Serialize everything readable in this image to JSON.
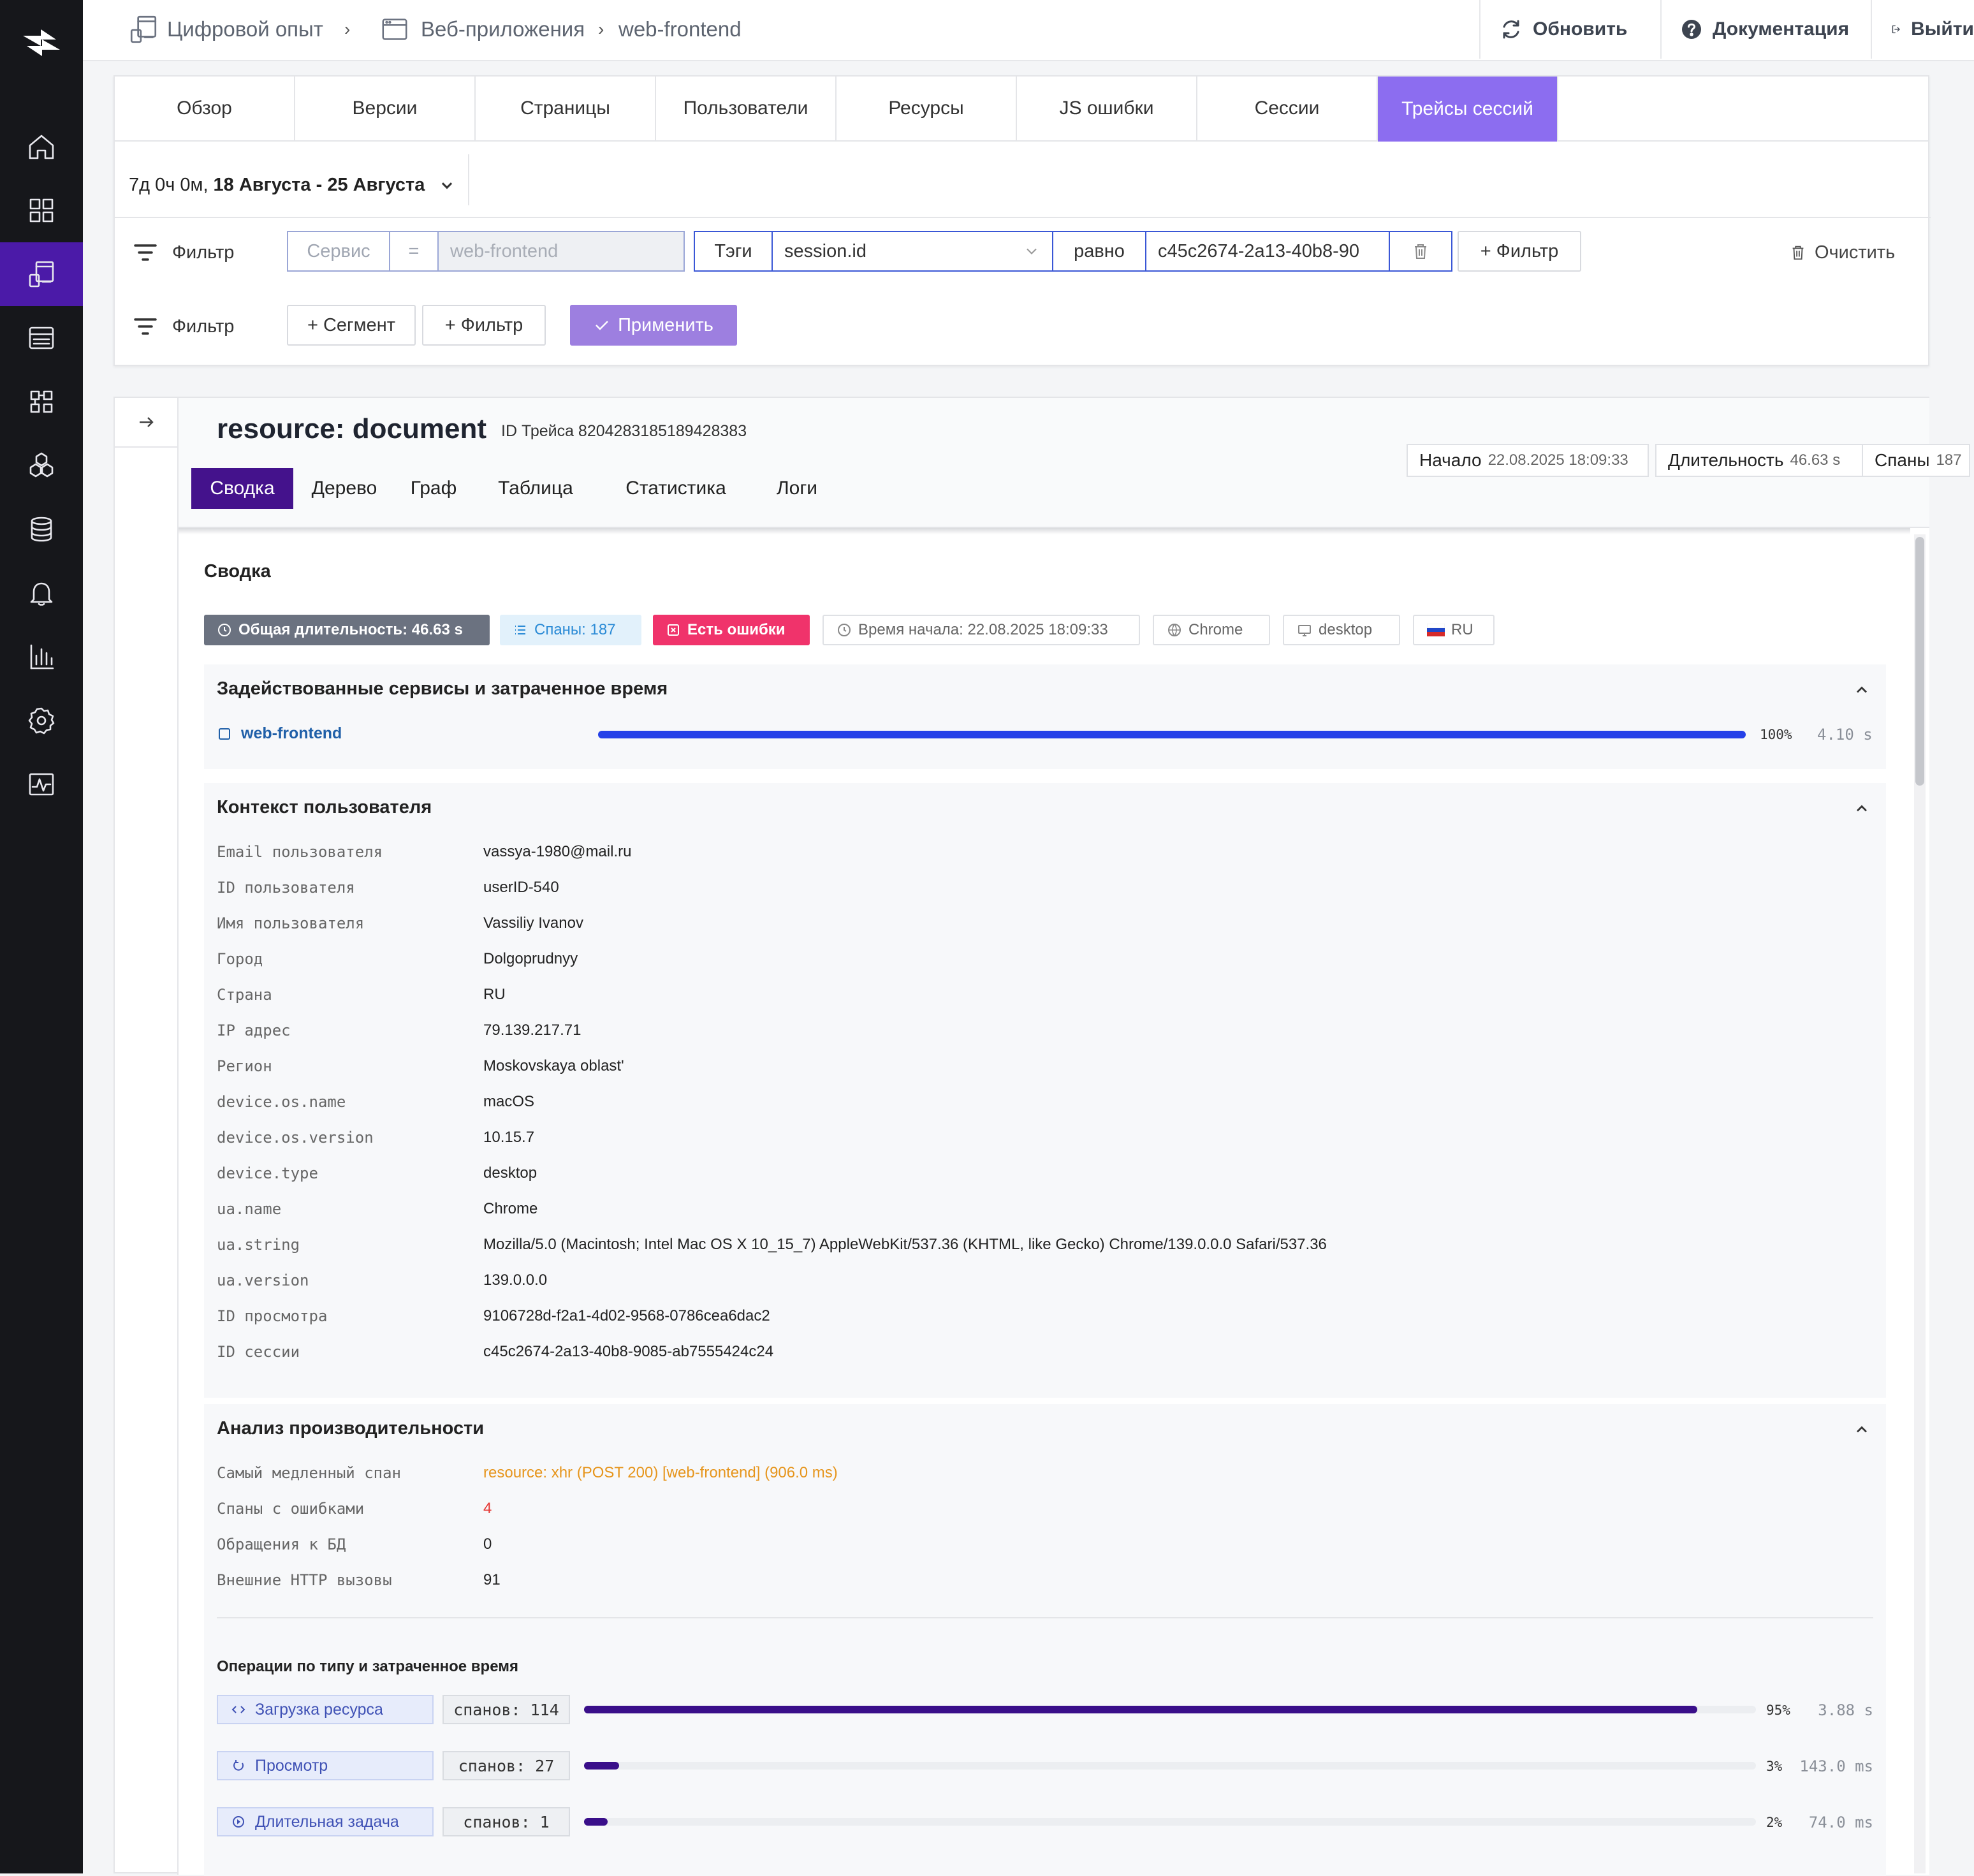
{
  "breadcrumbs": [
    "Цифровой опыт",
    "Веб-приложения",
    "web-frontend"
  ],
  "topbar": {
    "refresh": "Обновить",
    "docs": "Документация",
    "logout": "Выйти"
  },
  "sidebar": {
    "items": [
      {
        "icon": "home-icon"
      },
      {
        "icon": "dashboard-grid-icon"
      },
      {
        "icon": "digital-experience-icon",
        "active": true
      },
      {
        "icon": "logs-list-icon"
      },
      {
        "icon": "modules-icon"
      },
      {
        "icon": "hexagons-icon"
      },
      {
        "icon": "database-icon"
      },
      {
        "icon": "bell-icon"
      },
      {
        "icon": "bar-chart-icon"
      },
      {
        "icon": "settings-gear-icon"
      },
      {
        "icon": "monitoring-pulse-icon"
      }
    ]
  },
  "tabs": [
    "Обзор",
    "Версии",
    "Страницы",
    "Пользователи",
    "Ресурсы",
    "JS ошибки",
    "Сессии",
    "Трейсы сессий"
  ],
  "active_tab": "Трейсы сессий",
  "daterange": {
    "prefix": "7д 0ч 0м,",
    "range": "18 Августа - 25 Августа"
  },
  "filter1": {
    "label": "Фильтр",
    "service_placeholder": "Сервис",
    "op": "=",
    "service_value": "web-frontend",
    "tags_label": "Тэги",
    "tag_key": "session.id",
    "equals_label": "равно",
    "tag_value": "c45c2674-2a13-40b8-90",
    "add_filter": "+ Фильтр",
    "clear": "Очистить"
  },
  "filter2": {
    "label": "Фильтр",
    "add_segment": "+ Сегмент",
    "add_filter": "+ Фильтр",
    "apply": "Применить"
  },
  "trace": {
    "title": "resource: document",
    "id_label": "ID Трейса 8204283185189428383",
    "start_label": "Начало",
    "start_value": "22.08.2025 18:09:33",
    "duration_label": "Длительность",
    "duration_value": "46.63 s",
    "spans_label": "Спаны",
    "spans_value": "187",
    "subtabs": [
      "Сводка",
      "Дерево",
      "Граф",
      "Таблица",
      "Статистика",
      "Логи"
    ],
    "active_subtab": "Сводка"
  },
  "summary": {
    "title": "Сводка",
    "badges": {
      "total_duration": "Общая длительность: 46.63 s",
      "spans": "Спаны: 187",
      "errors": "Есть ошибки",
      "start_time": "Время начала: 22.08.2025 18:09:33",
      "browser": "Chrome",
      "device": "desktop",
      "country": "RU"
    },
    "services": {
      "title": "Задействованные сервисы и затраченное время",
      "rows": [
        {
          "name": "web-frontend",
          "percent": "100%",
          "percent_value": 100,
          "time": "4.10 s"
        }
      ]
    },
    "user_context": {
      "title": "Контекст пользователя",
      "rows": [
        {
          "k": "Email пользователя",
          "v": "vassya-1980@mail.ru"
        },
        {
          "k": "ID пользователя",
          "v": "userID-540"
        },
        {
          "k": "Имя пользователя",
          "v": "Vassiliy Ivanov"
        },
        {
          "k": "Город",
          "v": "Dolgoprudnyy"
        },
        {
          "k": "Страна",
          "v": "RU"
        },
        {
          "k": "IP адрес",
          "v": "79.139.217.71"
        },
        {
          "k": "Регион",
          "v": "Moskovskaya oblast'"
        },
        {
          "k": "device.os.name",
          "v": "macOS"
        },
        {
          "k": "device.os.version",
          "v": "10.15.7"
        },
        {
          "k": "device.type",
          "v": "desktop"
        },
        {
          "k": "ua.name",
          "v": "Chrome"
        },
        {
          "k": "ua.string",
          "v": "Mozilla/5.0 (Macintosh; Intel Mac OS X 10_15_7) AppleWebKit/537.36 (KHTML, like Gecko) Chrome/139.0.0.0 Safari/537.36"
        },
        {
          "k": "ua.version",
          "v": "139.0.0.0"
        },
        {
          "k": "ID просмотра",
          "v": "9106728d-f2a1-4d02-9568-0786cea6dac2"
        },
        {
          "k": "ID сессии",
          "v": "c45c2674-2a13-40b8-9085-ab7555424c24"
        }
      ]
    },
    "performance": {
      "title": "Анализ производительности",
      "rows": [
        {
          "k": "Самый медленный спан",
          "v": "resource: xhr (POST 200) [web-frontend] (906.0 ms)"
        },
        {
          "k": "Спаны с ошибками",
          "v": "4"
        },
        {
          "k": "Обращения к БД",
          "v": "0"
        },
        {
          "k": "Внешние HTTP вызовы",
          "v": "91"
        }
      ],
      "ops_title": "Операции по типу и затраченное время",
      "ops": [
        {
          "name": "Загрузка ресурса",
          "icon": "code-brackets-icon",
          "count": "спанов: 114",
          "percent": "95%",
          "percent_value": 95,
          "time": "3.88 s"
        },
        {
          "name": "Просмотр",
          "icon": "refresh-view-icon",
          "count": "спанов: 27",
          "percent": "3%",
          "percent_value": 3,
          "time": "143.0 ms"
        },
        {
          "name": "Длительная задача",
          "icon": "play-task-icon",
          "count": "спанов: 1",
          "percent": "2%",
          "percent_value": 2,
          "time": "74.0 ms"
        }
      ]
    }
  },
  "colors": {
    "brand": "#4b1aa8",
    "accent_tab": "#8c6df0",
    "subtab_active": "#44128c",
    "service_bar": "#2541e8",
    "error_badge": "#f0336b",
    "slowest_span": "#e6951c",
    "error_count": "#e53935"
  }
}
